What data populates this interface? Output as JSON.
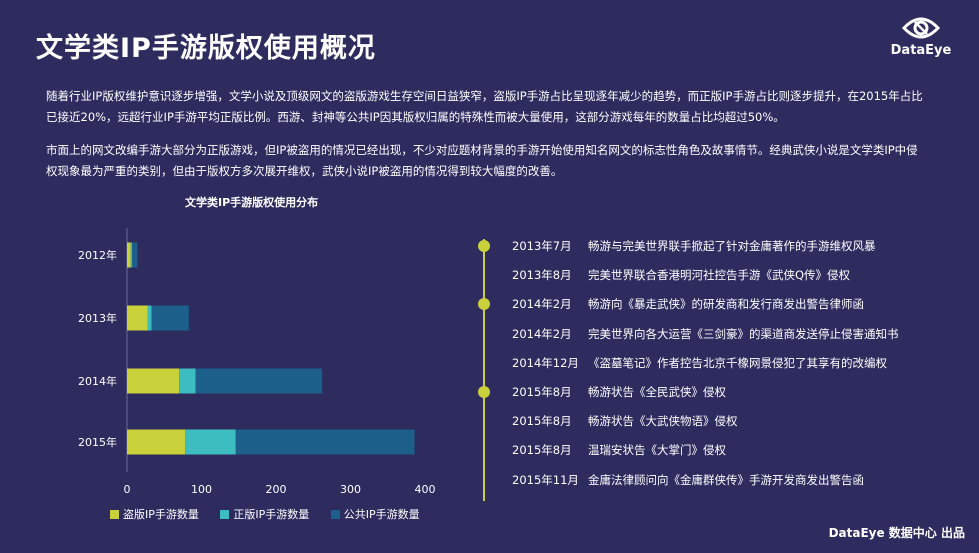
{
  "header": {
    "title": "文学类IP手游版权使用概况",
    "logo_text": "DataEye"
  },
  "paragraphs": [
    "随着行业IP版权维护意识逐步增强，文学小说及顶级网文的盗版游戏生存空间日益狭窄，盗版IP手游占比呈现逐年减少的趋势，而正版IP手游占比则逐步提升，在2015年占比已接近20%，远超行业IP手游平均正版比例。西游、封神等公共IP因其版权归属的特殊性而被大量使用，这部分游戏每年的数量占比均超过50%。",
    "市面上的网文改编手游大部分为正版游戏，但IP被盗用的情况已经出现，不少对应题材背景的手游开始使用知名网文的标志性角色及故事情节。经典武侠小说是文学类IP中侵权现象最为严重的类别，但由于版权方多次展开维权，武侠小说IP被盗用的情况得到较大幅度的改善。"
  ],
  "chart_data": {
    "type": "bar",
    "orientation": "horizontal",
    "stacked": true,
    "title": "文学类IP手游版权使用分布",
    "categories": [
      "2012年",
      "2013年",
      "2014年",
      "2015年"
    ],
    "series": [
      {
        "name": "盗版IP手游数量",
        "values": [
          5,
          28,
          70,
          78
        ],
        "color": "#c8d13a"
      },
      {
        "name": "正版IP手游数量",
        "values": [
          2,
          5,
          22,
          68
        ],
        "color": "#3ebdc0"
      },
      {
        "name": "公共IP手游数量",
        "values": [
          7,
          50,
          170,
          240
        ],
        "color": "#1b5f8a"
      }
    ],
    "xlim": [
      0,
      400
    ],
    "xticks": [
      0,
      100,
      200,
      300,
      400
    ],
    "legend_position": "bottom"
  },
  "timeline": [
    {
      "date": "2013年7月",
      "text": "畅游与完美世界联手掀起了针对金庸著作的手游维权风暴",
      "marker": true
    },
    {
      "date": "2013年8月",
      "text": "完美世界联合香港明河社控告手游《武侠Q传》侵权",
      "marker": false
    },
    {
      "date": "2014年2月",
      "text": "畅游向《暴走武侠》的研发商和发行商发出警告律师函",
      "marker": true
    },
    {
      "date": "2014年2月",
      "text": "完美世界向各大运营《三剑豪》的渠道商发送停止侵害通知书",
      "marker": false
    },
    {
      "date": "2014年12月",
      "text": "《盗墓笔记》作者控告北京千橡网景侵犯了其享有的改编权",
      "marker": false
    },
    {
      "date": "2015年8月",
      "text": "畅游状告《全民武侠》侵权",
      "marker": true
    },
    {
      "date": "2015年8月",
      "text": "畅游状告《大武侠物语》侵权",
      "marker": false
    },
    {
      "date": "2015年8月",
      "text": "温瑞安状告《大掌门》侵权",
      "marker": false
    },
    {
      "date": "2015年11月",
      "text": "金庸法律顾问向《金庸群侠传》手游开发商发出警告函",
      "marker": false
    }
  ],
  "footer": "DataEye 数据中心 出品"
}
